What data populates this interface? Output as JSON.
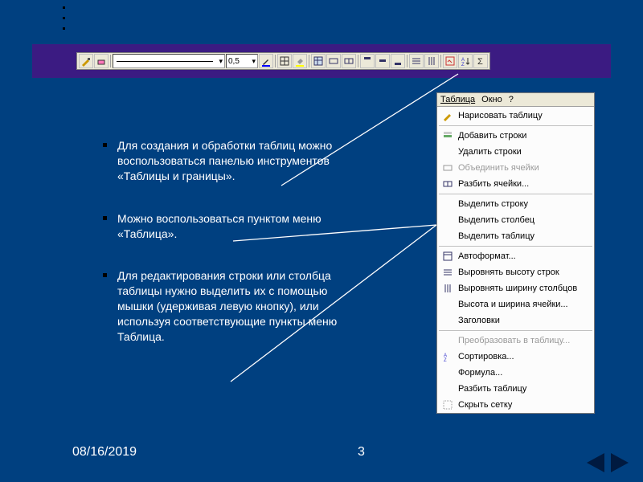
{
  "dots": true,
  "toolbar": {
    "line_width": "0,5",
    "items": [
      "draw-table-icon",
      "eraser-icon",
      "line-style",
      "line-weight",
      "pen-color",
      "border-menu-icon",
      "fill-color-icon",
      "insert-table-icon",
      "merge-cells-icon",
      "split-cells-icon",
      "align-top-icon",
      "align-center-icon",
      "align-bottom-icon",
      "distribute-rows-icon",
      "distribute-cols-icon",
      "autoformat-icon",
      "sort-asc-icon",
      "autosum-icon"
    ]
  },
  "bullets": [
    "Для создания и обработки таблиц можно воспользоваться панелью инструментов «Таблицы и границы».",
    "Можно воспользоваться пунктом меню «Таблица».",
    "Для редактирования строки или столбца таблицы нужно выделить их с помощью мышки (удерживая левую кнопку), или используя соответствующие пункты меню Таблица."
  ],
  "menubar": {
    "table": "Таблица",
    "window": "Окно",
    "help": "?"
  },
  "menu": {
    "draw": "Нарисовать таблицу",
    "add_rows": "Добавить строки",
    "del_rows": "Удалить строки",
    "merge": "Объединить ячейки",
    "split": "Разбить ячейки...",
    "sel_row": "Выделить строку",
    "sel_col": "Выделить столбец",
    "sel_table": "Выделить таблицу",
    "autoformat": "Автоформат...",
    "dist_rows": "Выровнять высоту строк",
    "dist_cols": "Выровнять ширину столбцов",
    "cell_size": "Высота и ширина ячейки...",
    "headings": "Заголовки",
    "convert": "Преобразовать в таблицу...",
    "sort": "Сортировка...",
    "formula": "Формула...",
    "split_tbl": "Разбить таблицу",
    "gridlines": "Скрыть сетку"
  },
  "footer": {
    "date": "08/16/2019",
    "page": "3"
  }
}
